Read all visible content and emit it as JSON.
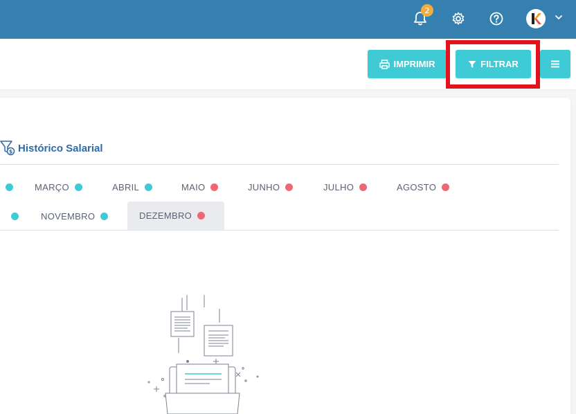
{
  "topbar": {
    "notifications": {
      "icon": "bell-icon",
      "count": "2"
    },
    "settings_icon": "gear-icon",
    "help_icon": "help-icon",
    "avatar_letter": "k",
    "dropdown_icon": "chevron-down-icon"
  },
  "toolbar": {
    "print_label": "IMPRIMIR",
    "filter_label": "FILTRAR",
    "menu_icon": "hamburger-icon"
  },
  "card": {
    "title": "Histórico Salarial",
    "title_icon": "salary-filter-icon"
  },
  "months": [
    {
      "label": "",
      "status": "cyan"
    },
    {
      "label": "MARÇO",
      "status": "cyan"
    },
    {
      "label": "ABRIL",
      "status": "cyan"
    },
    {
      "label": "MAIO",
      "status": "red"
    },
    {
      "label": "JUNHO",
      "status": "red"
    },
    {
      "label": "JULHO",
      "status": "red"
    },
    {
      "label": "AGOSTO",
      "status": "red"
    },
    {
      "label": "",
      "status": "cyan"
    },
    {
      "label": "NOVEMBRO",
      "status": "cyan"
    },
    {
      "label": "DEZEMBRO",
      "status": "red",
      "active": true
    }
  ],
  "colors": {
    "topbar": "#3580ae",
    "accent": "#3ecbd6",
    "title": "#2e6aa5",
    "status_ok": "#3ecbd6",
    "status_pending": "#ee6874",
    "highlight": "#e3131e"
  }
}
